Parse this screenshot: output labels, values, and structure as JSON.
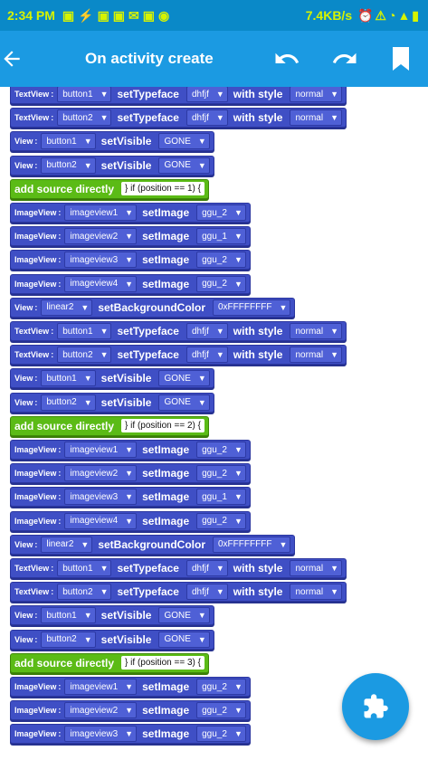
{
  "status": {
    "time": "2:34 PM",
    "speed": "7.4KB/s"
  },
  "appbar": {
    "title": "On activity create"
  },
  "blocks": [
    {
      "kind": "tf",
      "type": "TextView",
      "target": "button1",
      "font": "dhfjf",
      "style": "normal"
    },
    {
      "kind": "tf",
      "type": "TextView",
      "target": "button2",
      "font": "dhfjf",
      "style": "normal"
    },
    {
      "kind": "vis",
      "target": "button1",
      "value": "GONE"
    },
    {
      "kind": "vis",
      "target": "button2",
      "value": "GONE"
    },
    {
      "kind": "src",
      "code": "} if (position == 1) {"
    },
    {
      "kind": "img",
      "target": "imageview1",
      "image": "ggu_2"
    },
    {
      "kind": "img",
      "target": "imageview2",
      "image": "ggu_1"
    },
    {
      "kind": "img",
      "target": "imageview3",
      "image": "ggu_2"
    },
    {
      "kind": "img",
      "target": "imageview4",
      "image": "ggu_2"
    },
    {
      "kind": "bg",
      "target": "linear2",
      "color": "0xFFFFFFFF"
    },
    {
      "kind": "tf",
      "type": "TextView",
      "target": "button1",
      "font": "dhfjf",
      "style": "normal"
    },
    {
      "kind": "tf",
      "type": "TextView",
      "target": "button2",
      "font": "dhfjf",
      "style": "normal"
    },
    {
      "kind": "vis",
      "target": "button1",
      "value": "GONE"
    },
    {
      "kind": "vis",
      "target": "button2",
      "value": "GONE"
    },
    {
      "kind": "src",
      "code": "} if (position == 2) {"
    },
    {
      "kind": "img",
      "target": "imageview1",
      "image": "ggu_2"
    },
    {
      "kind": "img",
      "target": "imageview2",
      "image": "ggu_2"
    },
    {
      "kind": "img",
      "target": "imageview3",
      "image": "ggu_1"
    },
    {
      "kind": "img",
      "target": "imageview4",
      "image": "ggu_2"
    },
    {
      "kind": "bg",
      "target": "linear2",
      "color": "0xFFFFFFFF"
    },
    {
      "kind": "tf",
      "type": "TextView",
      "target": "button1",
      "font": "dhfjf",
      "style": "normal"
    },
    {
      "kind": "tf",
      "type": "TextView",
      "target": "button2",
      "font": "dhfjf",
      "style": "normal"
    },
    {
      "kind": "vis",
      "target": "button1",
      "value": "GONE"
    },
    {
      "kind": "vis",
      "target": "button2",
      "value": "GONE"
    },
    {
      "kind": "src",
      "code": "} if (position == 3) {"
    },
    {
      "kind": "img",
      "target": "imageview1",
      "image": "ggu_2"
    },
    {
      "kind": "img",
      "target": "imageview2",
      "image": "ggu_2"
    },
    {
      "kind": "img",
      "target": "imageview3",
      "image": "ggu_2"
    }
  ],
  "labels": {
    "setTypeface": "setTypeface",
    "withStyle": "with style",
    "setVisible": "setVisible",
    "setImage": "setImage",
    "setBackgroundColor": "setBackgroundColor",
    "addSource": "add source directly",
    "View": "View",
    "ImageView": "ImageView"
  }
}
